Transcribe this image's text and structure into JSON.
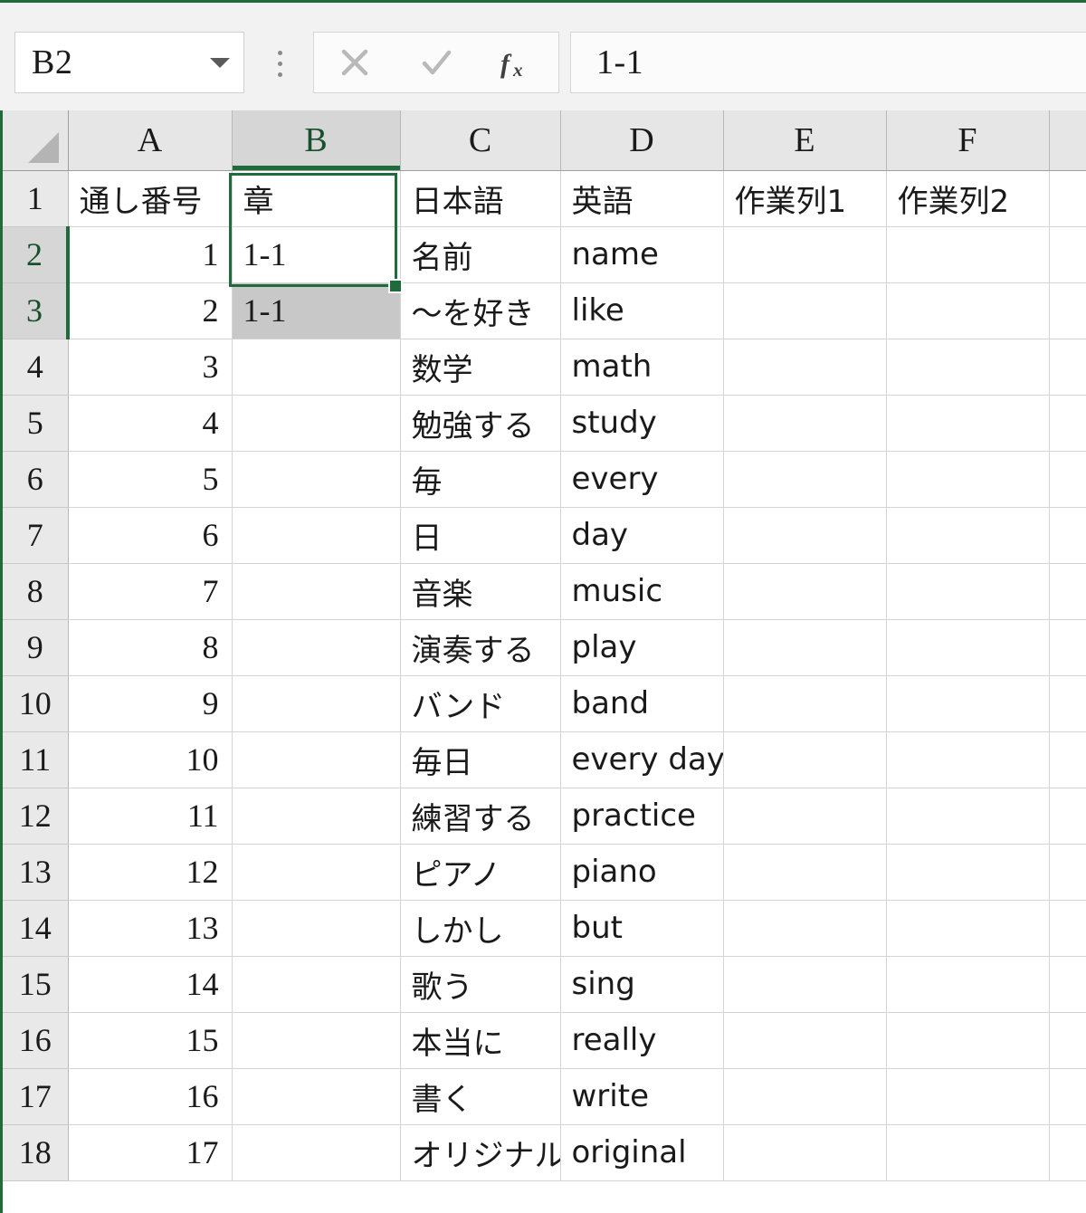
{
  "app": {
    "name_box": {
      "value": "B2",
      "dropdown_icon": "chevron-down-icon"
    },
    "grip_icon": "vertical-dots-grip-icon",
    "formula_buttons": {
      "cancel_label": "×",
      "cancel_icon": "cancel-x-icon",
      "enter_label": "✓",
      "enter_icon": "enter-check-icon",
      "function_label": "fx",
      "function_icon": "insert-function-icon"
    },
    "formula_bar": {
      "value": "1-1"
    }
  },
  "sheet": {
    "corner_icon": "select-all-triangle-icon",
    "column_headers": [
      "A",
      "B",
      "C",
      "D",
      "E",
      "F",
      ""
    ],
    "selected_column": "B",
    "selected_rows": [
      "2",
      "3"
    ],
    "selection_range": "B2:B3",
    "active_cell": "B2",
    "row_headers": [
      "1",
      "2",
      "3",
      "4",
      "5",
      "6",
      "7",
      "8",
      "9",
      "10",
      "11",
      "12",
      "13",
      "14",
      "15",
      "16",
      "17",
      "18"
    ],
    "header_row": {
      "A": "通し番号",
      "B": "章",
      "C": "日本語",
      "D": "英語",
      "E": "作業列1",
      "F": "作業列2",
      "G": ""
    },
    "rows": [
      {
        "row": "2",
        "A": "1",
        "B": "1-1",
        "C": "名前",
        "D": "name",
        "E": "",
        "F": "",
        "G": ""
      },
      {
        "row": "3",
        "A": "2",
        "B": "1-1",
        "C": "～を好き",
        "D": "like",
        "E": "",
        "F": "",
        "G": ""
      },
      {
        "row": "4",
        "A": "3",
        "B": "",
        "C": "数学",
        "D": "math",
        "E": "",
        "F": "",
        "G": ""
      },
      {
        "row": "5",
        "A": "4",
        "B": "",
        "C": "勉強する",
        "D": "study",
        "E": "",
        "F": "",
        "G": ""
      },
      {
        "row": "6",
        "A": "5",
        "B": "",
        "C": "毎",
        "D": "every",
        "E": "",
        "F": "",
        "G": ""
      },
      {
        "row": "7",
        "A": "6",
        "B": "",
        "C": "日",
        "D": "day",
        "E": "",
        "F": "",
        "G": ""
      },
      {
        "row": "8",
        "A": "7",
        "B": "",
        "C": "音楽",
        "D": "music",
        "E": "",
        "F": "",
        "G": ""
      },
      {
        "row": "9",
        "A": "8",
        "B": "",
        "C": "演奏する",
        "D": "play",
        "E": "",
        "F": "",
        "G": ""
      },
      {
        "row": "10",
        "A": "9",
        "B": "",
        "C": "バンド",
        "D": "band",
        "E": "",
        "F": "",
        "G": ""
      },
      {
        "row": "11",
        "A": "10",
        "B": "",
        "C": "毎日",
        "D": "every day",
        "E": "",
        "F": "",
        "G": ""
      },
      {
        "row": "12",
        "A": "11",
        "B": "",
        "C": "練習する",
        "D": "practice",
        "E": "",
        "F": "",
        "G": ""
      },
      {
        "row": "13",
        "A": "12",
        "B": "",
        "C": "ピアノ",
        "D": "piano",
        "E": "",
        "F": "",
        "G": ""
      },
      {
        "row": "14",
        "A": "13",
        "B": "",
        "C": "しかし",
        "D": "but",
        "E": "",
        "F": "",
        "G": ""
      },
      {
        "row": "15",
        "A": "14",
        "B": "",
        "C": "歌う",
        "D": "sing",
        "E": "",
        "F": "",
        "G": ""
      },
      {
        "row": "16",
        "A": "15",
        "B": "",
        "C": "本当に",
        "D": "really",
        "E": "",
        "F": "",
        "G": ""
      },
      {
        "row": "17",
        "A": "16",
        "B": "",
        "C": "書く",
        "D": "write",
        "E": "",
        "F": "",
        "G": ""
      },
      {
        "row": "18",
        "A": "17",
        "B": "",
        "C": "オリジナル",
        "D": "original",
        "E": "",
        "F": "",
        "G": ""
      }
    ]
  },
  "colors": {
    "selection_green": "#1f6b3b",
    "header_gray": "#e6e6e6",
    "selected_header_gray": "#d6d6d6",
    "fill_selection_gray": "#c8c8c8",
    "gridline": "#d4d4d4"
  }
}
